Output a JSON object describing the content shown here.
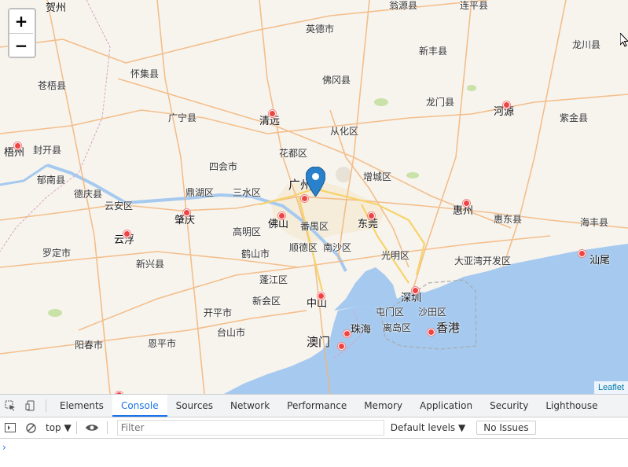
{
  "map": {
    "zoom_in_label": "+",
    "zoom_out_label": "−",
    "attribution": "Leaflet",
    "cities": [
      {
        "name": "贺州",
        "size": "big"
      },
      {
        "name": "翁源县",
        "size": "small"
      },
      {
        "name": "连平县",
        "size": "small"
      },
      {
        "name": "英德市",
        "size": "small"
      },
      {
        "name": "龙川县",
        "size": "small"
      },
      {
        "name": "新丰县",
        "size": "small"
      },
      {
        "name": "怀集县",
        "size": "small"
      },
      {
        "name": "佛冈县",
        "size": "small"
      },
      {
        "name": "苍梧县",
        "size": "small"
      },
      {
        "name": "龙门县",
        "size": "small"
      },
      {
        "name": "广宁县",
        "size": "small"
      },
      {
        "name": "清远",
        "size": "big"
      },
      {
        "name": "河源",
        "size": "big"
      },
      {
        "name": "紫金县",
        "size": "small"
      },
      {
        "name": "从化区",
        "size": "small"
      },
      {
        "name": "梧州",
        "size": "big"
      },
      {
        "name": "封开县",
        "size": "small"
      },
      {
        "name": "花都区",
        "size": "small"
      },
      {
        "name": "四会市",
        "size": "small"
      },
      {
        "name": "增城区",
        "size": "small"
      },
      {
        "name": "郁南县",
        "size": "small"
      },
      {
        "name": "广州",
        "size": "major"
      },
      {
        "name": "德庆县",
        "size": "small"
      },
      {
        "name": "鼎湖区",
        "size": "small"
      },
      {
        "name": "三水区",
        "size": "small"
      },
      {
        "name": "云安区",
        "size": "small"
      },
      {
        "name": "惠州",
        "size": "big"
      },
      {
        "name": "肇庆",
        "size": "big"
      },
      {
        "name": "佛山",
        "size": "big"
      },
      {
        "name": "番禺区",
        "size": "small"
      },
      {
        "name": "东莞",
        "size": "big"
      },
      {
        "name": "惠东县",
        "size": "small"
      },
      {
        "name": "海丰县",
        "size": "small"
      },
      {
        "name": "云浮",
        "size": "big"
      },
      {
        "name": "高明区",
        "size": "small"
      },
      {
        "name": "罗定市",
        "size": "small"
      },
      {
        "name": "顺德区",
        "size": "small"
      },
      {
        "name": "南沙区",
        "size": "small"
      },
      {
        "name": "光明区",
        "size": "small"
      },
      {
        "name": "新兴县",
        "size": "small"
      },
      {
        "name": "鹤山市",
        "size": "small"
      },
      {
        "name": "大亚湾开发区",
        "size": "small"
      },
      {
        "name": "汕尾",
        "size": "big"
      },
      {
        "name": "蓬江区",
        "size": "small"
      },
      {
        "name": "深圳",
        "size": "big"
      },
      {
        "name": "新会区",
        "size": "small"
      },
      {
        "name": "中山",
        "size": "big"
      },
      {
        "name": "屯门区",
        "size": "small"
      },
      {
        "name": "沙田区",
        "size": "small"
      },
      {
        "name": "开平市",
        "size": "small"
      },
      {
        "name": "台山市",
        "size": "small"
      },
      {
        "name": "珠海",
        "size": "big"
      },
      {
        "name": "离岛区",
        "size": "small"
      },
      {
        "name": "香港",
        "size": "major"
      },
      {
        "name": "阳春市",
        "size": "small"
      },
      {
        "name": "恩平市",
        "size": "small"
      },
      {
        "name": "澳门",
        "size": "major"
      }
    ]
  },
  "devtools": {
    "tabs": [
      "Elements",
      "Console",
      "Sources",
      "Network",
      "Performance",
      "Memory",
      "Application",
      "Security",
      "Lighthouse"
    ],
    "active_tab": "Console",
    "context": "top",
    "filter_placeholder": "Filter",
    "levels": "Default levels",
    "issues": "No Issues",
    "prompt": "›"
  }
}
